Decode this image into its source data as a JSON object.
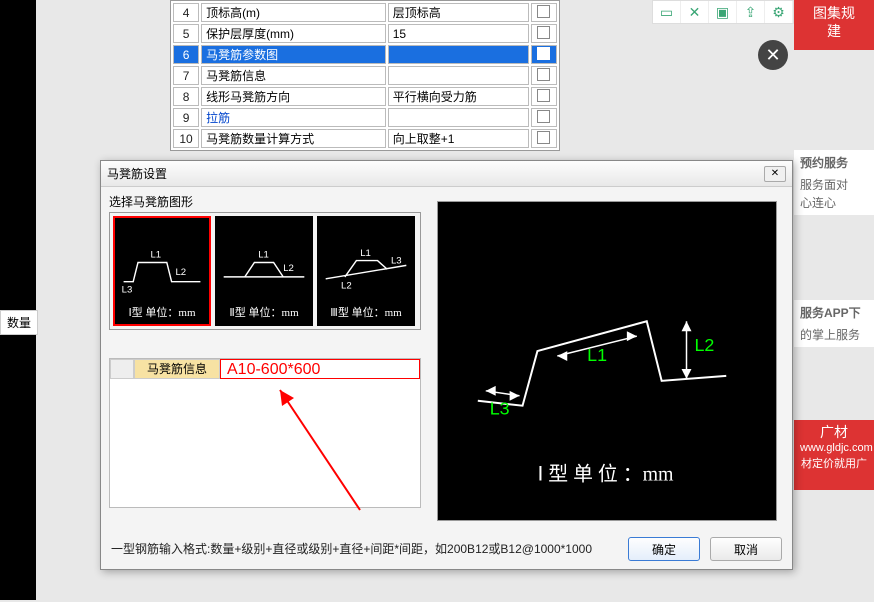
{
  "top_icons": [
    "phone",
    "expand",
    "save",
    "share",
    "gear"
  ],
  "right": {
    "banner1": "图集规",
    "banner2": "建",
    "svc_title": "预约服务",
    "svc_line1": "服务面对面，",
    "svc_line2": "心连心",
    "app_title": "服务APP下",
    "app_line1": "的掌上服务",
    "ad1": "广材",
    "ad_url": "www.gldjc.com",
    "ad2": "材定价就用广"
  },
  "bg_table": {
    "rows": [
      {
        "n": "4",
        "name": "顶标高(m)",
        "val": "层顶标高",
        "sel": false
      },
      {
        "n": "5",
        "name": "保护层厚度(mm)",
        "val": "15",
        "sel": false
      },
      {
        "n": "6",
        "name": "马凳筋参数图",
        "val": "",
        "sel": true
      },
      {
        "n": "7",
        "name": "马凳筋信息",
        "val": "",
        "sel": false
      },
      {
        "n": "8",
        "name": "线形马凳筋方向",
        "val": "平行横向受力筋",
        "sel": false
      },
      {
        "n": "9",
        "name": "拉筋",
        "val": "",
        "sel": false,
        "blue": true
      },
      {
        "n": "10",
        "name": "马凳筋数量计算方式",
        "val": "向上取整+1",
        "sel": false
      }
    ]
  },
  "dialog": {
    "title": "马凳筋设置",
    "group_label": "选择马凳筋图形",
    "shapes": [
      {
        "caption": "Ⅰ型 单位：mm",
        "labels": [
          "L1",
          "L2",
          "L3"
        ]
      },
      {
        "caption": "Ⅱ型 单位：mm",
        "labels": [
          "L1",
          "L2"
        ]
      },
      {
        "caption": "Ⅲ型 单位：mm",
        "labels": [
          "L1",
          "L2",
          "L3"
        ]
      }
    ],
    "info_label": "马凳筋信息",
    "info_value": "A10-600*600",
    "preview_caption": "Ⅰ 型 单 位 ：mm",
    "preview_labels": {
      "l1": "L1",
      "l2": "L2",
      "l3": "L3"
    },
    "hint": "一型钢筋输入格式:数量+级别+直径或级别+直径+间距*间距，如200B12或B12@1000*1000",
    "ok": "确定",
    "cancel": "取消"
  },
  "qty_label": "数量"
}
